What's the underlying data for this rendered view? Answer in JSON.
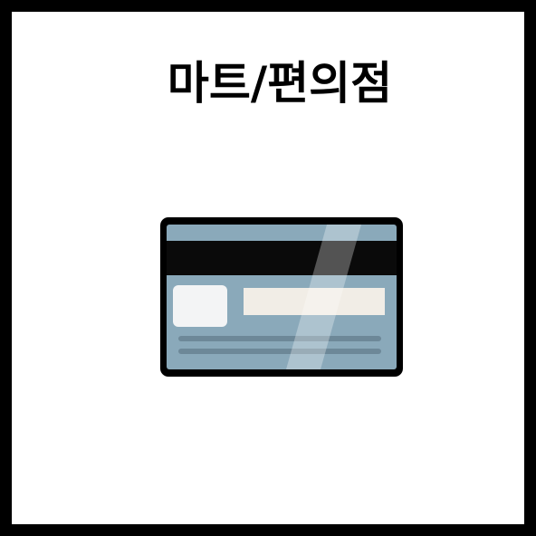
{
  "tile": {
    "title": "마트/편의점",
    "icon": "credit-card-back-icon"
  },
  "colors": {
    "border": "#000000",
    "background": "#ffffff",
    "card_body": "#8aa9ba",
    "card_outline": "#000000",
    "magnetic_stripe": "#0a0a0a",
    "signature_panel": "#f1ede6",
    "chip_box": "#f3f4f5",
    "card_lines": "#6d8898",
    "gloss": "#c9dbe4"
  }
}
